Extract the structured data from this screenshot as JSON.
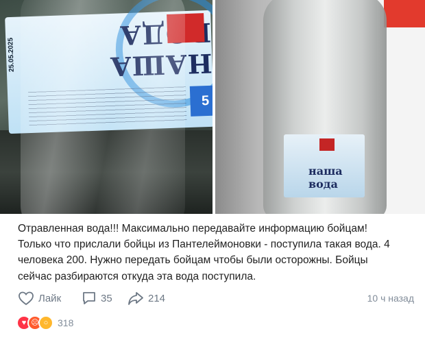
{
  "photos": {
    "left_bottle": {
      "brand_text": "НАША ВОДА",
      "date": "25.05.2025",
      "volume": "5"
    },
    "right_bottle": {
      "brand_text": "наша вода"
    }
  },
  "post": {
    "lines": [
      "Отравленная вода!!! Максимально передавайте информацию бойцам!",
      "Только что прислали бойцы из Пантелеймоновки - поступила такая вода. 4",
      "человека 200. Нужно передать бойцам чтобы были осторожны. Бойцы",
      "сейчас разбираются откуда эта вода поступила."
    ]
  },
  "actions": {
    "like_label": "Лайк",
    "comments_count": "35",
    "shares_count": "214",
    "time": "10 ч назад"
  },
  "reactions": {
    "icons": [
      "heart-reaction",
      "angry-reaction",
      "wow-reaction"
    ],
    "count": "318"
  },
  "colors": {
    "secondary_text": "#6d7885",
    "heart": "#ff3347"
  }
}
